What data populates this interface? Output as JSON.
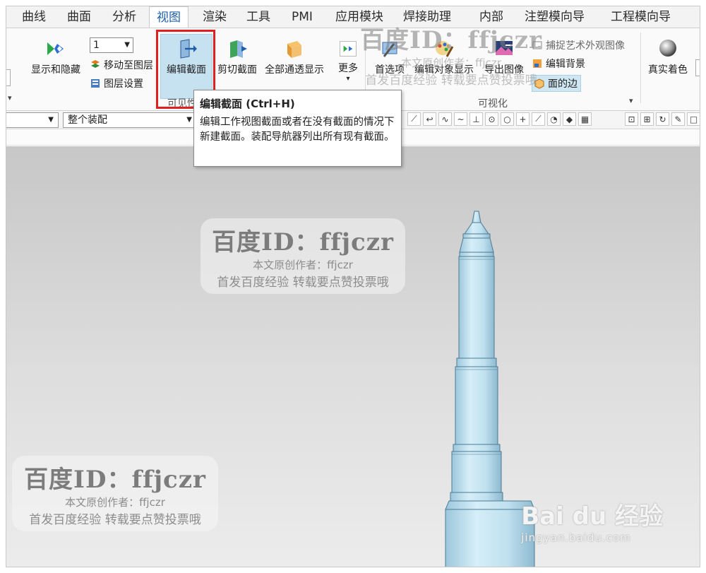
{
  "menu": {
    "items": [
      "曲线",
      "曲面",
      "分析",
      "视图",
      "渲染",
      "工具",
      "PMI",
      "应用模块",
      "焊接助理",
      "内部",
      "注塑模向导",
      "工程模向导"
    ],
    "active": "视图"
  },
  "ribbon": {
    "show_hide_label": "显示和隐藏",
    "layer_number": "1",
    "move_to_layer_label": "移动至图层",
    "layer_settings_label": "图层设置",
    "edit_section_label": "编辑截面",
    "clip_section_label": "剪切截面",
    "full_transparent_label": "全部通透显示",
    "more_label": "更多",
    "preferences_label": "首选项",
    "edit_object_display_label": "编辑对象显示",
    "export_image_label": "导出图像",
    "capture_art_label": "捕捉艺术外观图像",
    "edit_background_label": "编辑背景",
    "face_edges_label": "面的边",
    "true_shading_label": "真实着色",
    "group_visibility_label": "可见性",
    "group_visualization_label": "可视化"
  },
  "toolbar2": {
    "assembly_combo": "整个装配"
  },
  "tooltip": {
    "title": "编辑截面 (Ctrl+H)",
    "body": "编辑工作视图截面或者在没有截面的情况下新建截面。装配导航器列出所有现有截面。"
  },
  "watermark": {
    "title": "百度ID：ffjczr",
    "line1": "本文原创作者：ffjczr",
    "line2": "首发百度经验 转载要点赞投票哦"
  },
  "baidu_logo": {
    "main": "Bai du 经验",
    "sub": "jingyan.baidu.com"
  },
  "colors": {
    "highlight": "#e02020",
    "model": "#bfe0ef",
    "active_button": "#c6e2f1"
  }
}
